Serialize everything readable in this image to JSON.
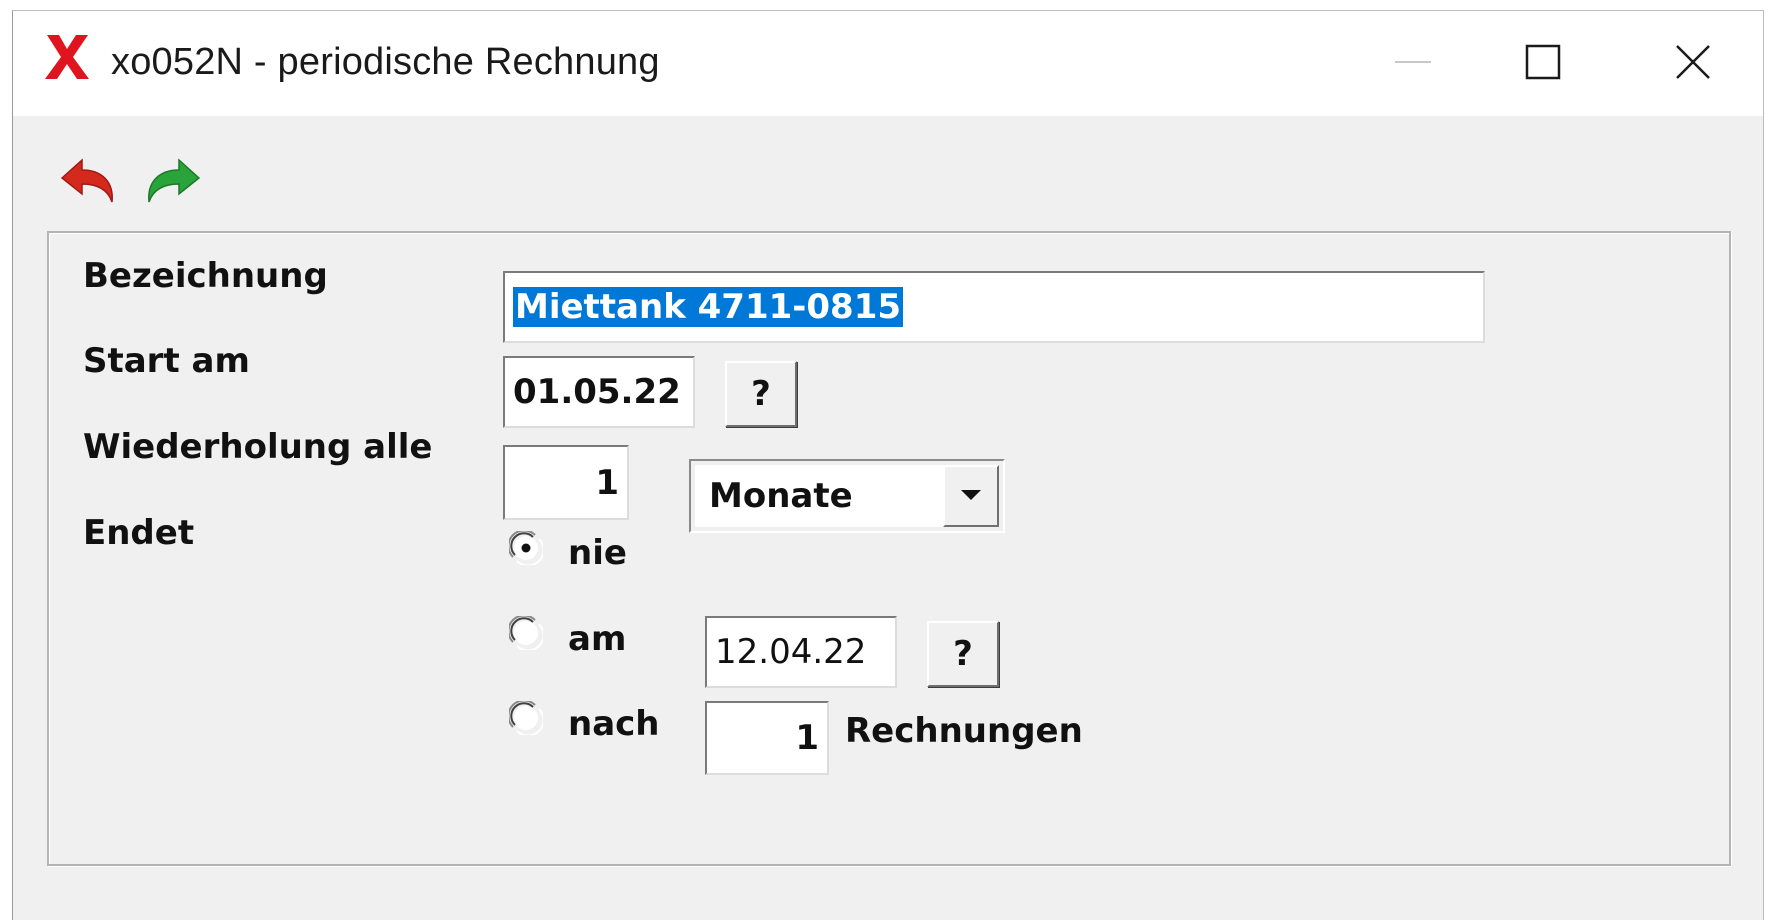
{
  "window": {
    "title": "xo052N - periodische Rechnung",
    "app_icon": "red-x-logo",
    "controls": {
      "minimize_icon": "minimize-icon",
      "maximize_icon": "maximize-icon",
      "close_icon": "close-icon"
    }
  },
  "toolbar": {
    "undo_icon": "undo-arrow-icon",
    "redo_icon": "redo-arrow-icon",
    "undo_color": "#d42a1e",
    "redo_color": "#2aa33a"
  },
  "form": {
    "bezeichnung": {
      "label": "Bezeichnung",
      "value": "Miettank 4711-0815"
    },
    "start": {
      "label": "Start am",
      "value": "01.05.22",
      "picker_label": "?"
    },
    "wiederholung": {
      "label": "Wiederholung alle",
      "count": "1",
      "unit": "Monate"
    },
    "endet": {
      "label": "Endet",
      "options": [
        {
          "label": "nie",
          "selected": true
        },
        {
          "label": "am",
          "selected": false,
          "value": "12.04.22",
          "picker_label": "?"
        },
        {
          "label": "nach",
          "selected": false,
          "value": "1",
          "suffix": "Rechnungen"
        }
      ]
    }
  },
  "colors": {
    "window_bg": "#f0f0f0",
    "selection": "#0078d7",
    "logo_red": "#e0141e"
  }
}
